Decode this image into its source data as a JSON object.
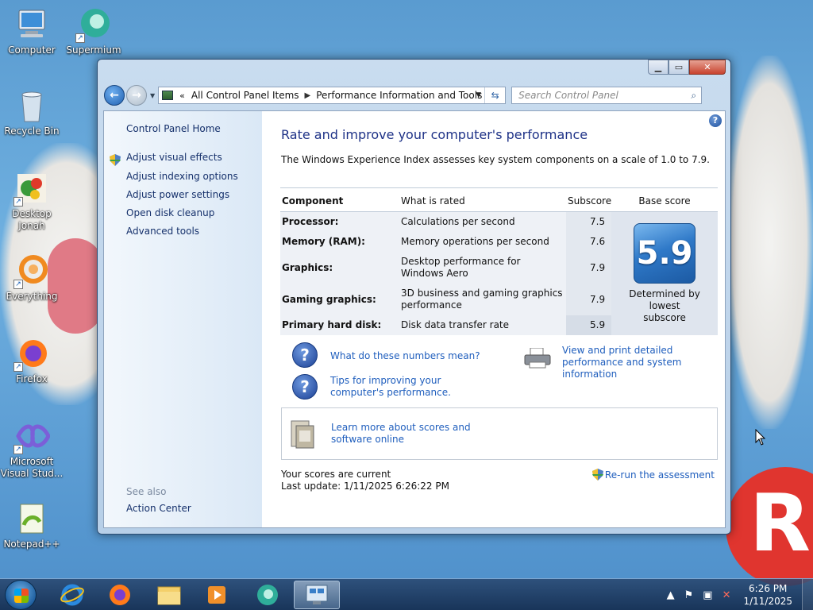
{
  "desktop": {
    "icons": [
      {
        "label": "Computer",
        "icon": "computer-icon"
      },
      {
        "label": "Supermium",
        "icon": "supermium-icon"
      },
      {
        "label": "Recycle Bin",
        "icon": "recycle-bin-icon"
      },
      {
        "label": "Desktop Jonah",
        "line1": "Desktop",
        "line2": "Jonah",
        "icon": "desktop-jonah-icon"
      },
      {
        "label": "Everything",
        "icon": "everything-icon"
      },
      {
        "label": "Firefox",
        "icon": "firefox-icon"
      },
      {
        "label": "Microsoft Visual Stud...",
        "line1": "Microsoft",
        "line2": "Visual Stud...",
        "icon": "visual-studio-icon"
      },
      {
        "label": "Notepad++",
        "icon": "notepadpp-icon"
      }
    ]
  },
  "window": {
    "address": {
      "root": "All Control Panel Items",
      "current": "Performance Information and Tools"
    },
    "search_placeholder": "Search Control Panel",
    "left_pane": {
      "home": "Control Panel Home",
      "links": [
        "Adjust visual effects",
        "Adjust indexing options",
        "Adjust power settings",
        "Open disk cleanup",
        "Advanced tools"
      ],
      "see_also": "See also",
      "action_center": "Action Center"
    },
    "main": {
      "title": "Rate and improve your computer's performance",
      "intro": "The Windows Experience Index assesses key system components on a scale of 1.0 to 7.9.",
      "table": {
        "headers": [
          "Component",
          "What is rated",
          "Subscore",
          "Base score"
        ],
        "rows": [
          {
            "component": "Processor:",
            "rated": "Calculations per second",
            "subscore": "7.5"
          },
          {
            "component": "Memory (RAM):",
            "rated": "Memory operations per second",
            "subscore": "7.6"
          },
          {
            "component": "Graphics:",
            "rated": "Desktop performance for Windows Aero",
            "subscore": "7.9"
          },
          {
            "component": "Gaming graphics:",
            "rated": "3D business and gaming graphics performance",
            "subscore": "7.9"
          },
          {
            "component": "Primary hard disk:",
            "rated": "Disk data transfer rate",
            "subscore": "5.9"
          }
        ],
        "base_score": "5.9",
        "base_caption": "Determined by lowest subscore"
      },
      "links": {
        "numbers": "What do these numbers mean?",
        "tips": "Tips for improving your computer's performance.",
        "print": "View and print detailed performance and system information",
        "learn": "Learn more about scores and software online"
      },
      "status": "Your scores are current",
      "last_update": "Last update: 1/11/2025 6:26:22 PM",
      "rerun": "Re-run the assessment"
    }
  },
  "taskbar": {
    "items": [
      "internet-explorer",
      "firefox",
      "file-explorer",
      "media-player",
      "supermium",
      "performance-tools"
    ],
    "clock_time": "6:26 PM",
    "clock_date": "1/11/2025"
  },
  "colors": {
    "link": "#1f5ebd",
    "title": "#1e3287",
    "score_badge": "#2f79c8"
  }
}
